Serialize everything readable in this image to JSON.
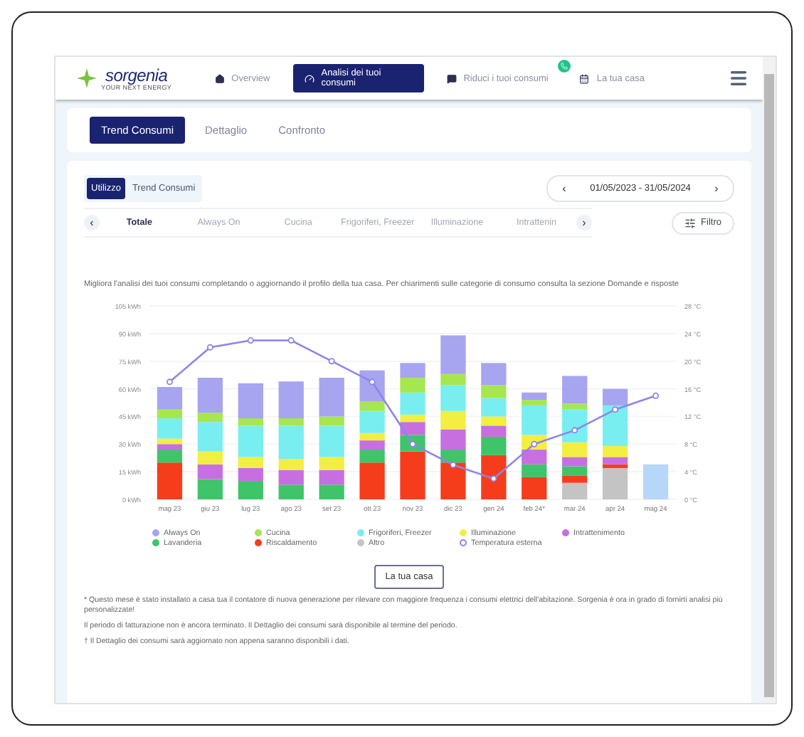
{
  "nav": {
    "logo": "sorgenia",
    "tagline": "YOUR NEXT ENERGY",
    "items": [
      {
        "label": "Overview",
        "selected": false,
        "badge": false
      },
      {
        "label": "Analisi dei tuoi consumi",
        "selected": true,
        "badge": false
      },
      {
        "label": "Riduci i tuoi consumi",
        "selected": false,
        "badge": true
      },
      {
        "label": "La tua casa",
        "selected": false,
        "badge": false
      }
    ]
  },
  "tabs": [
    {
      "label": "Trend Consumi",
      "selected": true
    },
    {
      "label": "Dettaglio",
      "selected": false
    },
    {
      "label": "Confronto",
      "selected": false
    }
  ],
  "toggle": [
    {
      "label": "Utilizzo",
      "selected": true
    },
    {
      "label": "Trend Consumi",
      "selected": false
    }
  ],
  "date_range": {
    "prev": "‹",
    "label": "01/05/2023 - 31/05/2024",
    "next": "›"
  },
  "categories": {
    "prev": "‹",
    "next": "›",
    "items": [
      {
        "label": "Totale",
        "selected": true
      },
      {
        "label": "Always On",
        "selected": false
      },
      {
        "label": "Cucina",
        "selected": false
      },
      {
        "label": "Frigoriferi, Freezer",
        "selected": false
      },
      {
        "label": "Illuminazione",
        "selected": false
      },
      {
        "label": "Intrattenin",
        "selected": false
      }
    ]
  },
  "filter_button": "Filtro",
  "intro": "Migliora l'analisi dei tuoi consumi completando o aggiornando il profilo della tua casa. Per chiarimenti sulle categorie di consumo consulta la sezione Domande e risposte",
  "chart_data": {
    "type": "bar",
    "stacked": true,
    "grid": true,
    "categories": [
      "mag 23",
      "giu 23",
      "lug 23",
      "ago 23",
      "set 23",
      "ott 23",
      "nov 23",
      "dic 23",
      "gen 24",
      "feb 24*",
      "mar 24",
      "apr 24",
      "mag 24"
    ],
    "ylim": [
      0,
      105
    ],
    "yticks": [
      {
        "value": 0,
        "label": "0 kWh"
      },
      {
        "value": 15,
        "label": "15 kWh"
      },
      {
        "value": 30,
        "label": "30 kWh"
      },
      {
        "value": 45,
        "label": "45 kWh"
      },
      {
        "value": 60,
        "label": "60 kWh"
      },
      {
        "value": 75,
        "label": "75 kWh"
      },
      {
        "value": 90,
        "label": "90 kWh"
      },
      {
        "value": 105,
        "label": "105 kWh"
      }
    ],
    "y2lim": [
      0,
      28
    ],
    "y2ticks": [
      {
        "value": 0,
        "label": "0 °C"
      },
      {
        "value": 4,
        "label": "4 °C"
      },
      {
        "value": 8,
        "label": "8 °C"
      },
      {
        "value": 12,
        "label": "12 °C"
      },
      {
        "value": 16,
        "label": "16 °C"
      },
      {
        "value": 20,
        "label": "20 °C"
      },
      {
        "value": 24,
        "label": "24 °C"
      },
      {
        "value": 28,
        "label": "28 °C"
      }
    ],
    "series": [
      {
        "name": "Always On",
        "color": "#a7a4f0",
        "values": [
          12,
          19,
          19,
          20,
          21,
          17,
          8,
          21,
          12,
          4,
          15,
          9,
          null
        ]
      },
      {
        "name": "Cucina",
        "color": "#a6e64f",
        "values": [
          5,
          5,
          4,
          4,
          5,
          5,
          8,
          6,
          7,
          3,
          3,
          0,
          null
        ]
      },
      {
        "name": "Frigoriferi, Freezer",
        "color": "#78eef0",
        "values": [
          11,
          16,
          17,
          18,
          17,
          12,
          12,
          14,
          10,
          16,
          18,
          22,
          null
        ]
      },
      {
        "name": "Illuminazione",
        "color": "#f2ee42",
        "values": [
          3,
          7,
          6,
          6,
          7,
          4,
          4,
          10,
          5,
          8,
          8,
          6,
          null
        ]
      },
      {
        "name": "Intrattenimento",
        "color": "#c76fe0",
        "values": [
          3,
          8,
          7,
          8,
          8,
          5,
          7,
          11,
          6,
          8,
          5,
          4,
          null
        ]
      },
      {
        "name": "Lavanderia",
        "color": "#3fc46a",
        "values": [
          7,
          11,
          10,
          8,
          8,
          7,
          9,
          7,
          10,
          7,
          5,
          0,
          null
        ]
      },
      {
        "name": "Riscaldamento",
        "color": "#f53d1c",
        "values": [
          20,
          0,
          0,
          0,
          0,
          20,
          26,
          20,
          24,
          12,
          4,
          2,
          null
        ]
      },
      {
        "name": "Altro",
        "color": "#c4c4c4",
        "values": [
          0,
          0,
          0,
          0,
          0,
          0,
          0,
          0,
          0,
          0,
          9,
          17,
          null
        ]
      },
      {
        "color": "#b6d7f7",
        "values": [
          null,
          null,
          null,
          null,
          null,
          null,
          null,
          null,
          null,
          null,
          null,
          null,
          19
        ]
      },
      {
        "name": "Temperatura esterna",
        "type": "line",
        "marker": true,
        "axis": "y2",
        "color": "#8f84e6",
        "values": [
          17,
          22,
          23,
          23,
          20,
          17,
          8,
          5,
          3,
          8,
          10,
          13,
          15
        ]
      }
    ]
  },
  "home_button": "La tua casa",
  "notes": [
    "* Questo mese è stato installato a casa tua il contatore di nuova generazione per rilevare con maggiore frequenza i consumi elettrici dell'abitazione. Sorgenia è ora in grado di fornirti analisi più personalizzate!",
    "Il periodo di fatturazione non è ancora terminato. Il Dettaglio dei consumi sarà disponibile al termine del periodo.",
    "† Il Dettaglio dei consumi sarà aggiornato non appena saranno disponibili i dati."
  ]
}
